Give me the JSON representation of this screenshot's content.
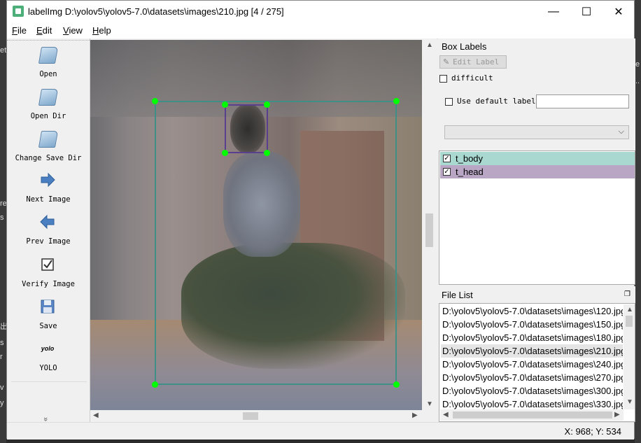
{
  "window": {
    "title": "labelImg D:\\yolov5\\yolov5-7.0\\datasets\\images\\210.jpg [4 / 275]",
    "controls": {
      "minimize": "—",
      "maximize": "☐",
      "close": "✕"
    }
  },
  "menu": [
    {
      "underline": "F",
      "rest": "ile"
    },
    {
      "underline": "E",
      "rest": "dit"
    },
    {
      "underline": "V",
      "rest": "iew"
    },
    {
      "underline": "H",
      "rest": "elp"
    }
  ],
  "toolbar": [
    {
      "label": "Open",
      "icon": "folder-open-icon"
    },
    {
      "label": "Open Dir",
      "icon": "folder-icon"
    },
    {
      "label": "Change Save Dir",
      "icon": "folder-save-icon"
    },
    {
      "label": "Next Image",
      "icon": "arrow-right-icon"
    },
    {
      "label": "Prev Image",
      "icon": "arrow-left-icon"
    },
    {
      "label": "Verify Image",
      "icon": "checkbox-icon"
    },
    {
      "label": "Save",
      "icon": "floppy-icon"
    },
    {
      "label": "YOLO",
      "icon": "yolo-icon",
      "icon_text": "yolo"
    }
  ],
  "toolbar_more": "»",
  "box_labels": {
    "title": "Box Labels",
    "edit_label": "Edit Label",
    "difficult": "difficult",
    "use_default_label": "Use default label",
    "default_label_value": "",
    "dropdown_value": "",
    "labels": [
      {
        "text": "t_body",
        "checked": true,
        "color": "#a8d8d0"
      },
      {
        "text": "t_head",
        "checked": true,
        "color": "#b8a6c4"
      }
    ]
  },
  "file_list": {
    "title": "File List",
    "files": [
      "D:\\yolov5\\yolov5-7.0\\datasets\\images\\120.jpg",
      "D:\\yolov5\\yolov5-7.0\\datasets\\images\\150.jpg",
      "D:\\yolov5\\yolov5-7.0\\datasets\\images\\180.jpg",
      "D:\\yolov5\\yolov5-7.0\\datasets\\images\\210.jpg",
      "D:\\yolov5\\yolov5-7.0\\datasets\\images\\240.jpg",
      "D:\\yolov5\\yolov5-7.0\\datasets\\images\\270.jpg",
      "D:\\yolov5\\yolov5-7.0\\datasets\\images\\300.jpg",
      "D:\\yolov5\\yolov5-7.0\\datasets\\images\\330.jpg"
    ],
    "selected_index": 3
  },
  "status": {
    "coords": "X: 968; Y: 534"
  },
  "colors": {
    "handle": "#00ff00",
    "body_box": "#3f8f86",
    "head_box": "#5a3f8f",
    "selected_file": "#e5e5e5"
  }
}
